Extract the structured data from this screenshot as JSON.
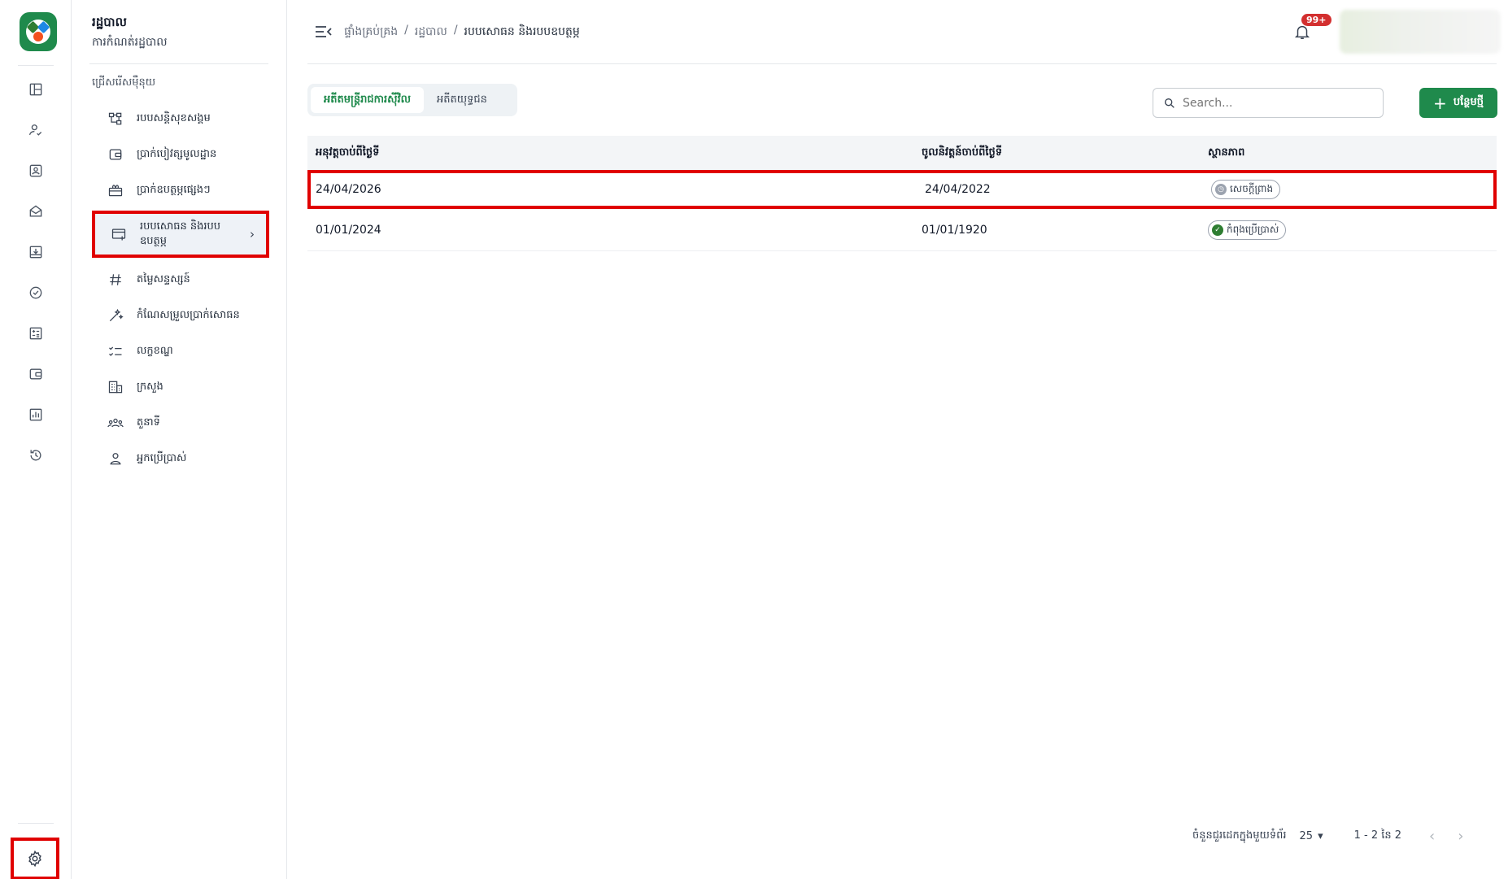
{
  "app": {
    "title": "រដ្ឋបាល",
    "subtitle": "ការកំណត់រដ្ឋបាល"
  },
  "rail": {
    "items": [
      "dashboard-icon",
      "person-check-icon",
      "id-card-icon",
      "mail-open-icon",
      "inbox-download-icon",
      "verified-badge-icon",
      "calculator-icon",
      "wallet-icon",
      "bar-chart-icon",
      "history-icon"
    ],
    "settings": "gear-icon"
  },
  "sidebar": {
    "section": "ជ្រើសរើសម៉ឺនុយ",
    "items": [
      {
        "label": "របបសន្តិសុខសង្គម",
        "icon": "hierarchy-icon"
      },
      {
        "label": "ប្រាក់បៀវត្សមូលដ្ឋាន",
        "icon": "wallet-icon"
      },
      {
        "label": "ប្រាក់ឧបត្ថម្ភផ្សេងៗ",
        "icon": "gift-icon"
      },
      {
        "label": "របបសោធន និងរបបឧបត្ថម្ភ",
        "icon": "card-add-icon",
        "active": true
      },
      {
        "label": "តម្លៃសន្ទស្សន៍",
        "icon": "hash-icon"
      },
      {
        "label": "កំណែសម្រួលប្រាក់សោធន",
        "icon": "magic-icon"
      },
      {
        "label": "លក្ខខណ្ឌ",
        "icon": "checklist-icon"
      },
      {
        "label": "ក្រសួង",
        "icon": "building-icon"
      },
      {
        "label": "តួនាទី",
        "icon": "group-icon"
      },
      {
        "label": "អ្នកប្រើប្រាស់",
        "icon": "user-icon"
      }
    ]
  },
  "header": {
    "breadcrumb": [
      "ផ្ទាំងគ្រប់គ្រង",
      "រដ្ឋបាល",
      "របបសោធន និងរបបឧបត្ថម្ភ"
    ],
    "separator": "/",
    "notification_count": "99+"
  },
  "tabs": [
    {
      "label": "អតីតមន្ត្រីរាជការស៊ីវិល",
      "active": true
    },
    {
      "label": "អតីតយុទ្ធជន",
      "active": false
    }
  ],
  "search": {
    "placeholder": "Search..."
  },
  "add_button": {
    "label": "បន្ថែមថ្មី"
  },
  "table": {
    "columns": [
      "អនុវត្តចាប់ពីថ្ងៃទី",
      "ចូលនិវត្តន៍ចាប់ពីថ្ងៃទី",
      "ស្ថានភាព"
    ],
    "rows": [
      {
        "effective": "24/04/2026",
        "retire_from": "24/04/2022",
        "status": "សេចក្តីព្រាង",
        "status_type": "draft"
      },
      {
        "effective": "01/01/2024",
        "retire_from": "01/01/1920",
        "status": "កំពុងប្រើប្រាស់",
        "status_type": "active"
      }
    ]
  },
  "pagination": {
    "rows_per_page_label": "ចំនួនជួរដេកក្នុងមួយទំព័រ",
    "rows_per_page": "25",
    "range": "1 - 2 នៃ 2"
  },
  "colors": {
    "brand": "#1f8a4c",
    "highlight": "#e00000",
    "badge": "#d32f2f"
  }
}
